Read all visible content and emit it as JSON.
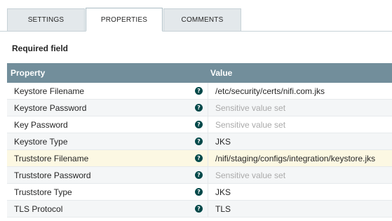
{
  "tabs": [
    {
      "label": "SETTINGS"
    },
    {
      "label": "PROPERTIES"
    },
    {
      "label": "COMMENTS"
    }
  ],
  "required_label": "Required field",
  "table": {
    "headers": {
      "property": "Property",
      "value": "Value"
    },
    "rows": [
      {
        "name": "Keystore Filename",
        "value": "/etc/security/certs/nifi.com.jks",
        "sensitive": false
      },
      {
        "name": "Keystore Password",
        "value": "Sensitive value set",
        "sensitive": true
      },
      {
        "name": "Key Password",
        "value": "Sensitive value set",
        "sensitive": true
      },
      {
        "name": "Keystore Type",
        "value": "JKS",
        "sensitive": false
      },
      {
        "name": "Truststore Filename",
        "value": "/nifi/staging/configs/integration/keystore.jks",
        "sensitive": false
      },
      {
        "name": "Truststore Password",
        "value": "Sensitive value set",
        "sensitive": true
      },
      {
        "name": "Truststore Type",
        "value": "JKS",
        "sensitive": false
      },
      {
        "name": "TLS Protocol",
        "value": "TLS",
        "sensitive": false
      }
    ]
  },
  "active_tab": "PROPERTIES",
  "selected_row": "Truststore Filename",
  "colors": {
    "header_bg": "#728e9b",
    "help_icon": "#004849",
    "selected_row": "#fcf8e3",
    "sensitive_text": "#aaaaaa"
  }
}
